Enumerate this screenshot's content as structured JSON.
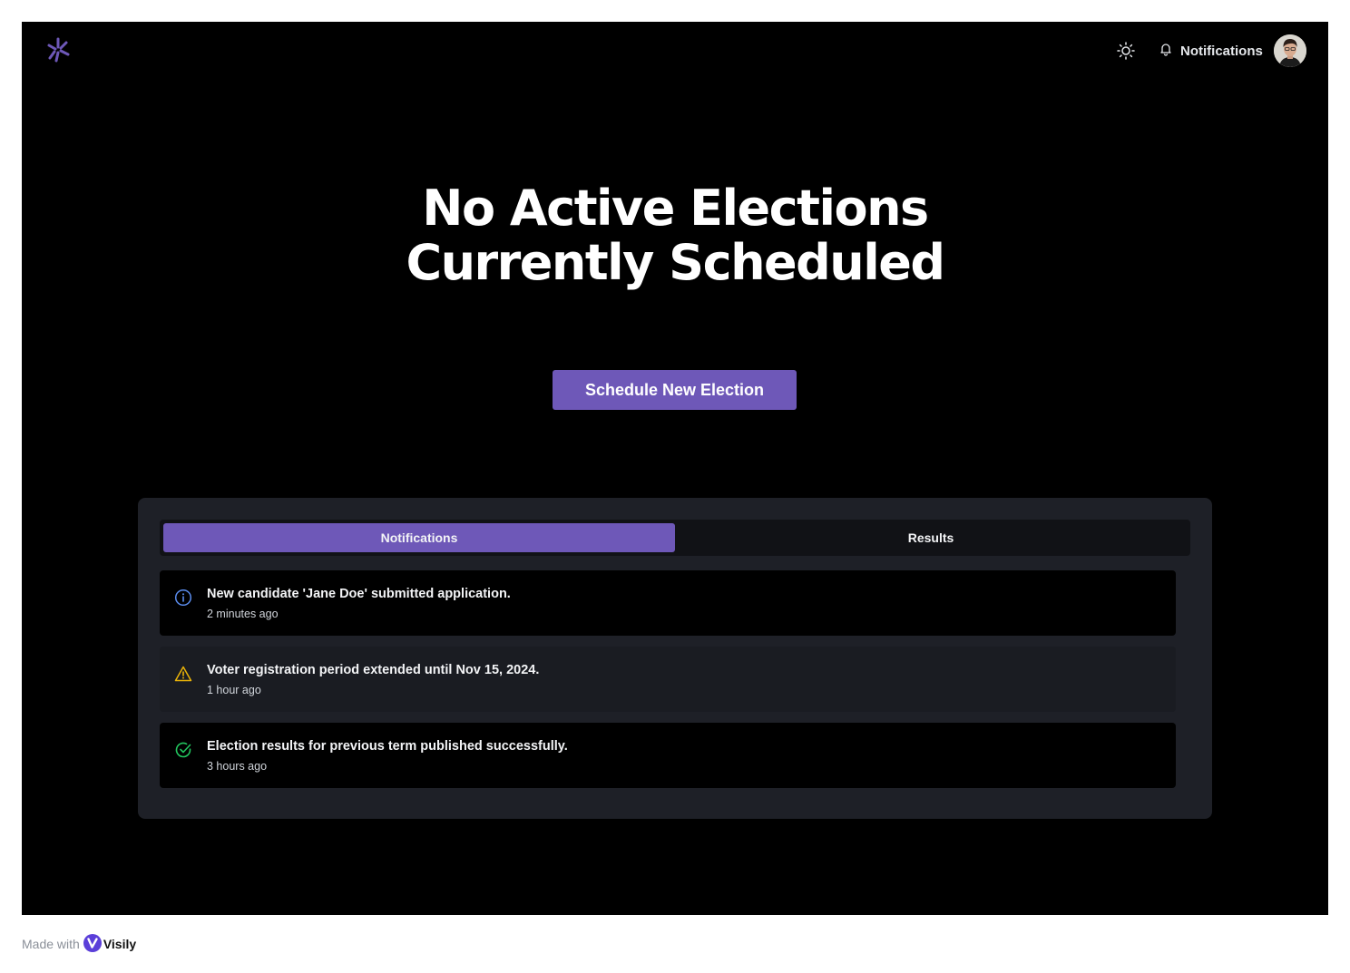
{
  "header": {
    "logo_icon": "asterisk-logo-icon",
    "theme_icon": "sun-icon",
    "notifications_icon": "bell-icon",
    "notifications_label": "Notifications",
    "avatar_alt": "user-avatar"
  },
  "hero": {
    "title_line1": "No Active Elections",
    "title_line2": "Currently Scheduled",
    "cta_label": "Schedule New Election"
  },
  "tabs": [
    {
      "label": "Notifications",
      "active": true
    },
    {
      "label": "Results",
      "active": false
    }
  ],
  "notifications": [
    {
      "icon": "info-icon",
      "message": "New candidate 'Jane Doe' submitted application.",
      "time": "2 minutes ago"
    },
    {
      "icon": "warning-icon",
      "message": "Voter registration period extended until Nov 15, 2024.",
      "time": "1 hour ago"
    },
    {
      "icon": "check-circle-icon",
      "message": "Election results for previous term published successfully.",
      "time": "3 hours ago"
    }
  ],
  "footer": {
    "prefix": "Made with",
    "brand": "Visily"
  },
  "colors": {
    "accent": "#6e58b8",
    "background": "#000000",
    "panel": "#1e2027",
    "info": "#5b8def",
    "warning": "#eab308",
    "success": "#22c55e"
  }
}
